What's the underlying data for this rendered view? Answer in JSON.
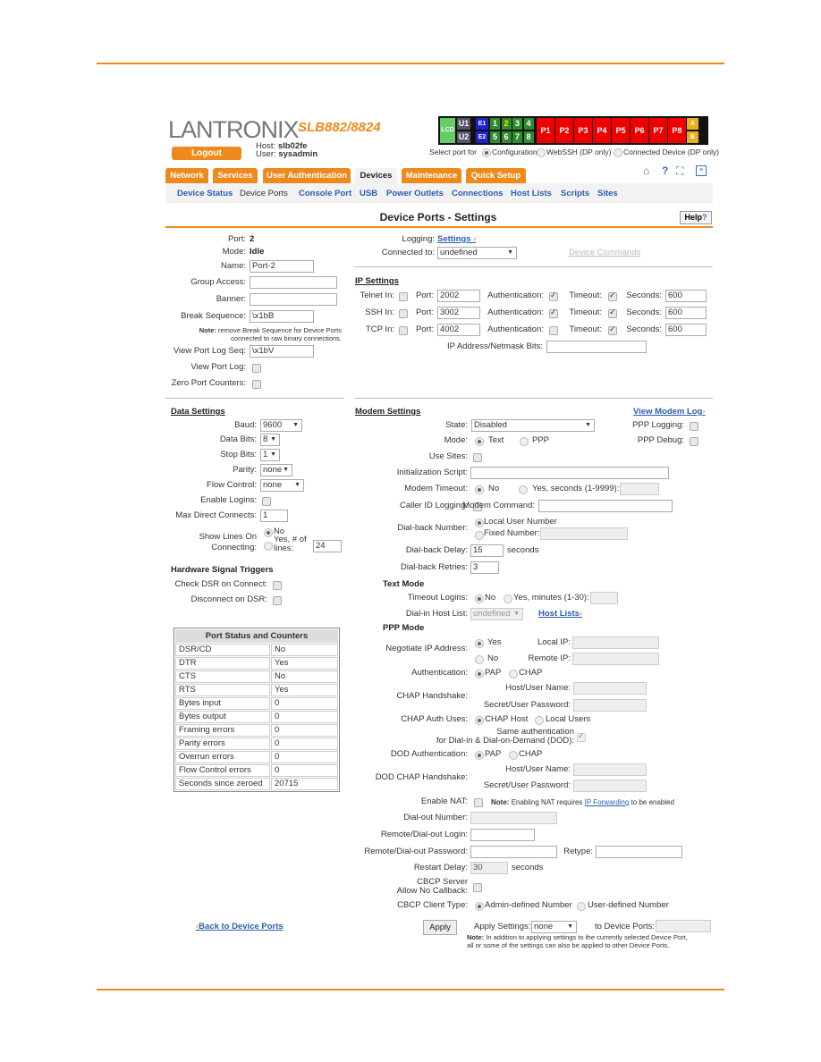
{
  "header": {
    "logo": "LANTRONIX",
    "model": "SLB882/8824",
    "logout": "Logout",
    "host_label": "Host:",
    "host": "slb02fe",
    "user_label": "User:",
    "user": "sysadmin",
    "ports": {
      "lcd": "LCD",
      "u": [
        "U1",
        "U2"
      ],
      "e": [
        "E1",
        "E2"
      ],
      "num": [
        "1",
        "2",
        "3",
        "4",
        "5",
        "6",
        "7",
        "8"
      ],
      "p": [
        "P1",
        "P2",
        "P3",
        "P4",
        "P5",
        "P6",
        "P7",
        "P8"
      ],
      "ab": [
        "A",
        "B"
      ]
    },
    "select_for": "Select port for",
    "modes": [
      {
        "label": "Configuration",
        "on": true
      },
      {
        "label": "WebSSH (DP only)",
        "on": false
      },
      {
        "label": "Connected Device (DP only)",
        "on": false
      }
    ],
    "colors": {
      "accent": "#ee8a1c",
      "link": "#2a5db0",
      "port_red": "#ee0000",
      "port_green": "#2e8b2e"
    }
  },
  "tabs": [
    "Network",
    "Services",
    "User Authentication",
    "Devices",
    "Maintenance",
    "Quick Setup"
  ],
  "active_tab": "Devices",
  "icons": [
    "home-icon",
    "help-icon",
    "network-icon",
    "log-icon"
  ],
  "subnav": [
    "Device Status",
    "Device Ports",
    "Console Port",
    "USB",
    "Power Outlets",
    "Connections",
    "Host Lists",
    "Scripts",
    "Sites"
  ],
  "title": "Device Ports - Settings",
  "help": "Help",
  "port": {
    "port_label": "Port:",
    "port": "2",
    "mode_label": "Mode:",
    "mode": "Idle",
    "name_label": "Name:",
    "name": "Port-2",
    "group_label": "Group Access:",
    "group": "",
    "banner_label": "Banner:",
    "banner": "",
    "break_label": "Break Sequence:",
    "break": "\\x1bB",
    "note_b": "Note:",
    "note1": "remove Break Sequence for Device Ports",
    "note2": "connected to raw binary connections.",
    "viewseq_label": "View Port Log Seq:",
    "viewseq": "\\x1bV",
    "viewlog_label": "View Port Log:",
    "viewlog": false,
    "zero_label": "Zero Port Counters:",
    "zero": false,
    "logging_label": "Logging:",
    "logging_link": "Settings",
    "connected_label": "Connected to:",
    "connected": "undefined",
    "device_commands": "Device Commands"
  },
  "ip": {
    "title": "IP Settings",
    "rows": [
      {
        "label": "Telnet In:",
        "on": false,
        "port": "2002",
        "auth": true,
        "timeout": true,
        "seconds": "600"
      },
      {
        "label": "SSH In:",
        "on": false,
        "port": "3002",
        "auth": true,
        "timeout": true,
        "seconds": "600"
      },
      {
        "label": "TCP In:",
        "on": false,
        "port": "4002",
        "auth": false,
        "timeout": true,
        "seconds": "600"
      }
    ],
    "port_label": "Port:",
    "auth_label": "Authentication:",
    "timeout_label": "Timeout:",
    "seconds_label": "Seconds:",
    "netmask_label": "IP Address/Netmask Bits:",
    "netmask": ""
  },
  "data": {
    "title": "Data Settings",
    "baud_label": "Baud:",
    "baud": "9600",
    "databits_label": "Data Bits:",
    "databits": "8",
    "stopbits_label": "Stop Bits:",
    "stopbits": "1",
    "parity_label": "Parity:",
    "parity": "none",
    "flow_label": "Flow Control:",
    "flow": "none",
    "logins_label": "Enable Logins:",
    "logins": false,
    "maxconn_label": "Max Direct Connects:",
    "maxconn": "1",
    "showlines_label1": "Show Lines On",
    "showlines_label2": "Connecting:",
    "no": "No",
    "yes1": "Yes, # of",
    "yes2": "lines:",
    "lines": "24",
    "showlines_no": true,
    "hw_title": "Hardware Signal Triggers",
    "dsr_label": "Check DSR on Connect:",
    "dsr": false,
    "disc_label": "Disconnect on DSR:",
    "disc": false
  },
  "counters": {
    "title": "Port Status and Counters",
    "rows": [
      [
        "DSR/CD",
        "No"
      ],
      [
        "DTR",
        "Yes"
      ],
      [
        "CTS",
        "No"
      ],
      [
        "RTS",
        "Yes"
      ],
      [
        "Bytes input",
        "0"
      ],
      [
        "Bytes output",
        "0"
      ],
      [
        "Framing errors",
        "0"
      ],
      [
        "Parity errors",
        "0"
      ],
      [
        "Overrun errors",
        "0"
      ],
      [
        "Flow Control errors",
        "0"
      ],
      [
        "Seconds since zeroed",
        "20715"
      ]
    ]
  },
  "modem": {
    "title": "Modem Settings",
    "view_log": "View Modem Log",
    "state_label": "State:",
    "state": "Disabled",
    "ppplog_label": "PPP Logging:",
    "pppdebug_label": "PPP Debug:",
    "mode_label": "Mode:",
    "text": "Text",
    "ppp": "PPP",
    "sites_label": "Use Sites:",
    "init_label": "Initialization Script:",
    "init": "",
    "timeout_label": "Modem Timeout:",
    "no": "No",
    "yes_sec": "Yes, seconds (1-9999):",
    "callerid_label": "Caller ID Logging:",
    "cmd_label": "Modem Command:",
    "cmd": "",
    "dialback_label": "Dial-back Number:",
    "local_user": "Local User Number",
    "fixed": "Fixed Number:",
    "delay_label": "Dial-back Delay:",
    "delay": "15",
    "seconds": "seconds",
    "retries_label": "Dial-back Retries:",
    "retries": "3",
    "textmode": "Text Mode",
    "tlogins_label": "Timeout Logins:",
    "yes_min": "Yes, minutes (1-30):",
    "hostlist_label": "Dial-in Host List:",
    "hostlist": "undefined",
    "hostlists_link": "Host Lists",
    "pppmode": "PPP Mode",
    "negotiate_label": "Negotiate IP Address:",
    "yes": "Yes",
    "local_ip": "Local IP:",
    "remote_ip": "Remote IP:",
    "auth_label": "Authentication:",
    "pap": "PAP",
    "chap": "CHAP",
    "chap_hs": "CHAP Handshake:",
    "host_user": "Host/User Name:",
    "secret": "Secret/User Password:",
    "chap_uses": "CHAP Auth Uses:",
    "chap_host": "CHAP Host",
    "local_users": "Local Users",
    "same1": "Same authentication",
    "same2": "for Dial-in & Dial-on-Demand (DOD):",
    "dod_auth": "DOD Authentication:",
    "dod_hs": "DOD CHAP Handshake:",
    "nat_label": "Enable NAT:",
    "nat_note_b": "Note:",
    "nat_note": "Enabling NAT requires",
    "ipfwd": "IP Forwarding",
    "nat_note2": "to be enabled",
    "dialout_label": "Dial-out Number:",
    "login_label": "Remote/Dial-out Login:",
    "pass_label": "Remote/Dial-out Password:",
    "retype": "Retype:",
    "restart_label": "Restart Delay:",
    "restart": "30",
    "cbcp1": "CBCP Server",
    "cbcp2": "Allow No Callback:",
    "cbcp_type": "CBCP Client Type:",
    "admin_num": "Admin-defined Number",
    "user_num": "User-defined Number"
  },
  "footer": {
    "back": "Back to Device Ports",
    "apply": "Apply",
    "apply_settings": "Apply Settings:",
    "apply_sel": "none",
    "to_ports": "to Device Ports:",
    "note_b": "Note:",
    "note1": "In addition to applying settings to the currently selected Device Port,",
    "note2": "all or some of the settings can also be applied to other Device Ports."
  }
}
